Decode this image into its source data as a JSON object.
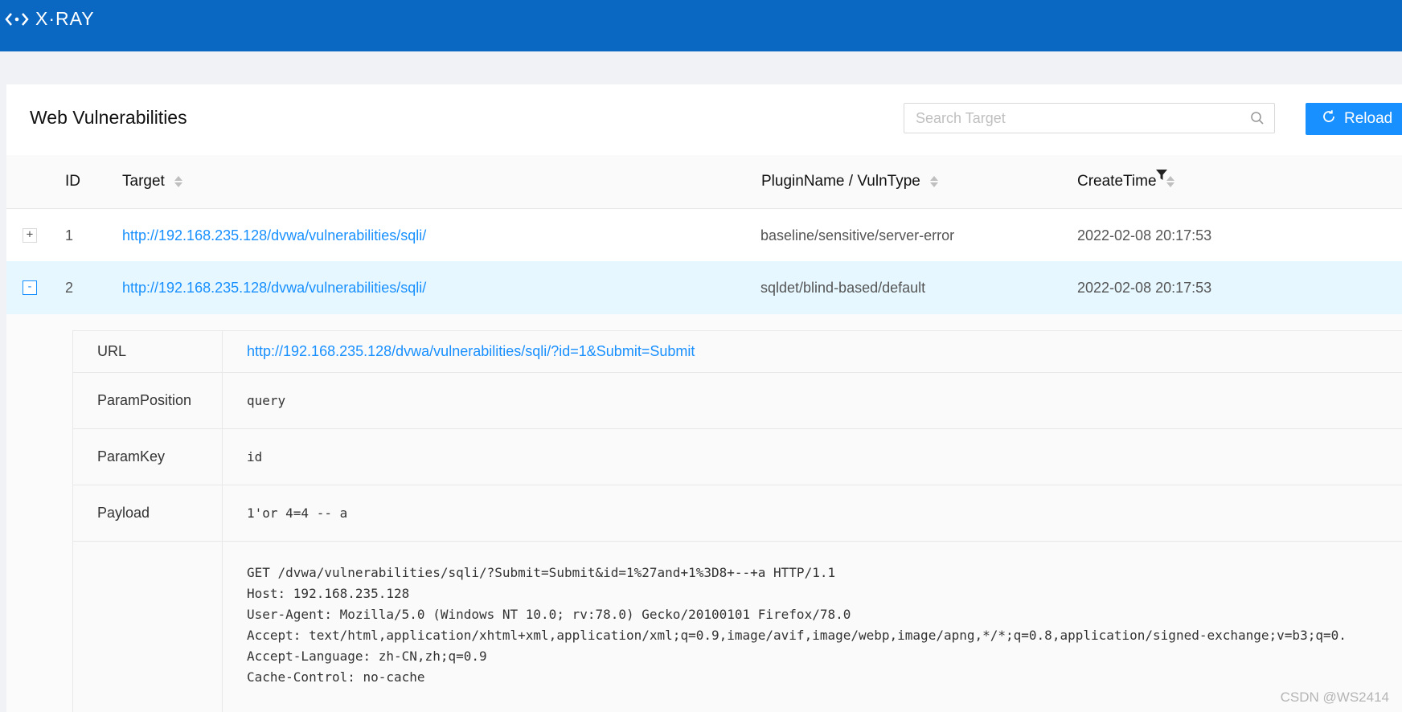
{
  "app": {
    "logo_text": "X·RAY",
    "brand_color": "#0a67c2",
    "accent_color": "#1890ff"
  },
  "page": {
    "title": "Web Vulnerabilities"
  },
  "search": {
    "placeholder": "Search Target",
    "value": ""
  },
  "toolbar": {
    "reload_label": "Reload"
  },
  "table": {
    "columns": {
      "id": "ID",
      "target": "Target",
      "plugin": "PluginName / VulnType",
      "create_time": "CreateTime"
    },
    "rows": [
      {
        "expand": "+",
        "id": "1",
        "target": "http://192.168.235.128/dvwa/vulnerabilities/sqli/",
        "plugin": "baseline/sensitive/server-error",
        "create_time": "2022-02-08 20:17:53"
      },
      {
        "expand": "-",
        "id": "2",
        "target": "http://192.168.235.128/dvwa/vulnerabilities/sqli/",
        "plugin": "sqldet/blind-based/default",
        "create_time": "2022-02-08 20:17:53"
      }
    ]
  },
  "detail": {
    "url_label": "URL",
    "url_value": "http://192.168.235.128/dvwa/vulnerabilities/sqli/?id=1&Submit=Submit",
    "param_position_label": "ParamPosition",
    "param_position_value": "query",
    "param_key_label": "ParamKey",
    "param_key_value": "id",
    "payload_label": "Payload",
    "payload_value": "1'or 4=4 -- a",
    "request_lines": [
      "GET /dvwa/vulnerabilities/sqli/?Submit=Submit&id=1%27and+1%3D8+--+a HTTP/1.1",
      "Host: 192.168.235.128",
      "User-Agent: Mozilla/5.0 (Windows NT 10.0; rv:78.0) Gecko/20100101 Firefox/78.0",
      "Accept: text/html,application/xhtml+xml,application/xml;q=0.9,image/avif,image/webp,image/apng,*/*;q=0.8,application/signed-exchange;v=b3;q=0.",
      "Accept-Language: zh-CN,zh;q=0.9",
      "Cache-Control: no-cache"
    ]
  },
  "watermark": "CSDN @WS2414",
  "icons": [
    "xray-logo-icon",
    "search-icon",
    "reload-icon",
    "sort-icon",
    "filter-icon",
    "expand-icon",
    "collapse-icon"
  ]
}
